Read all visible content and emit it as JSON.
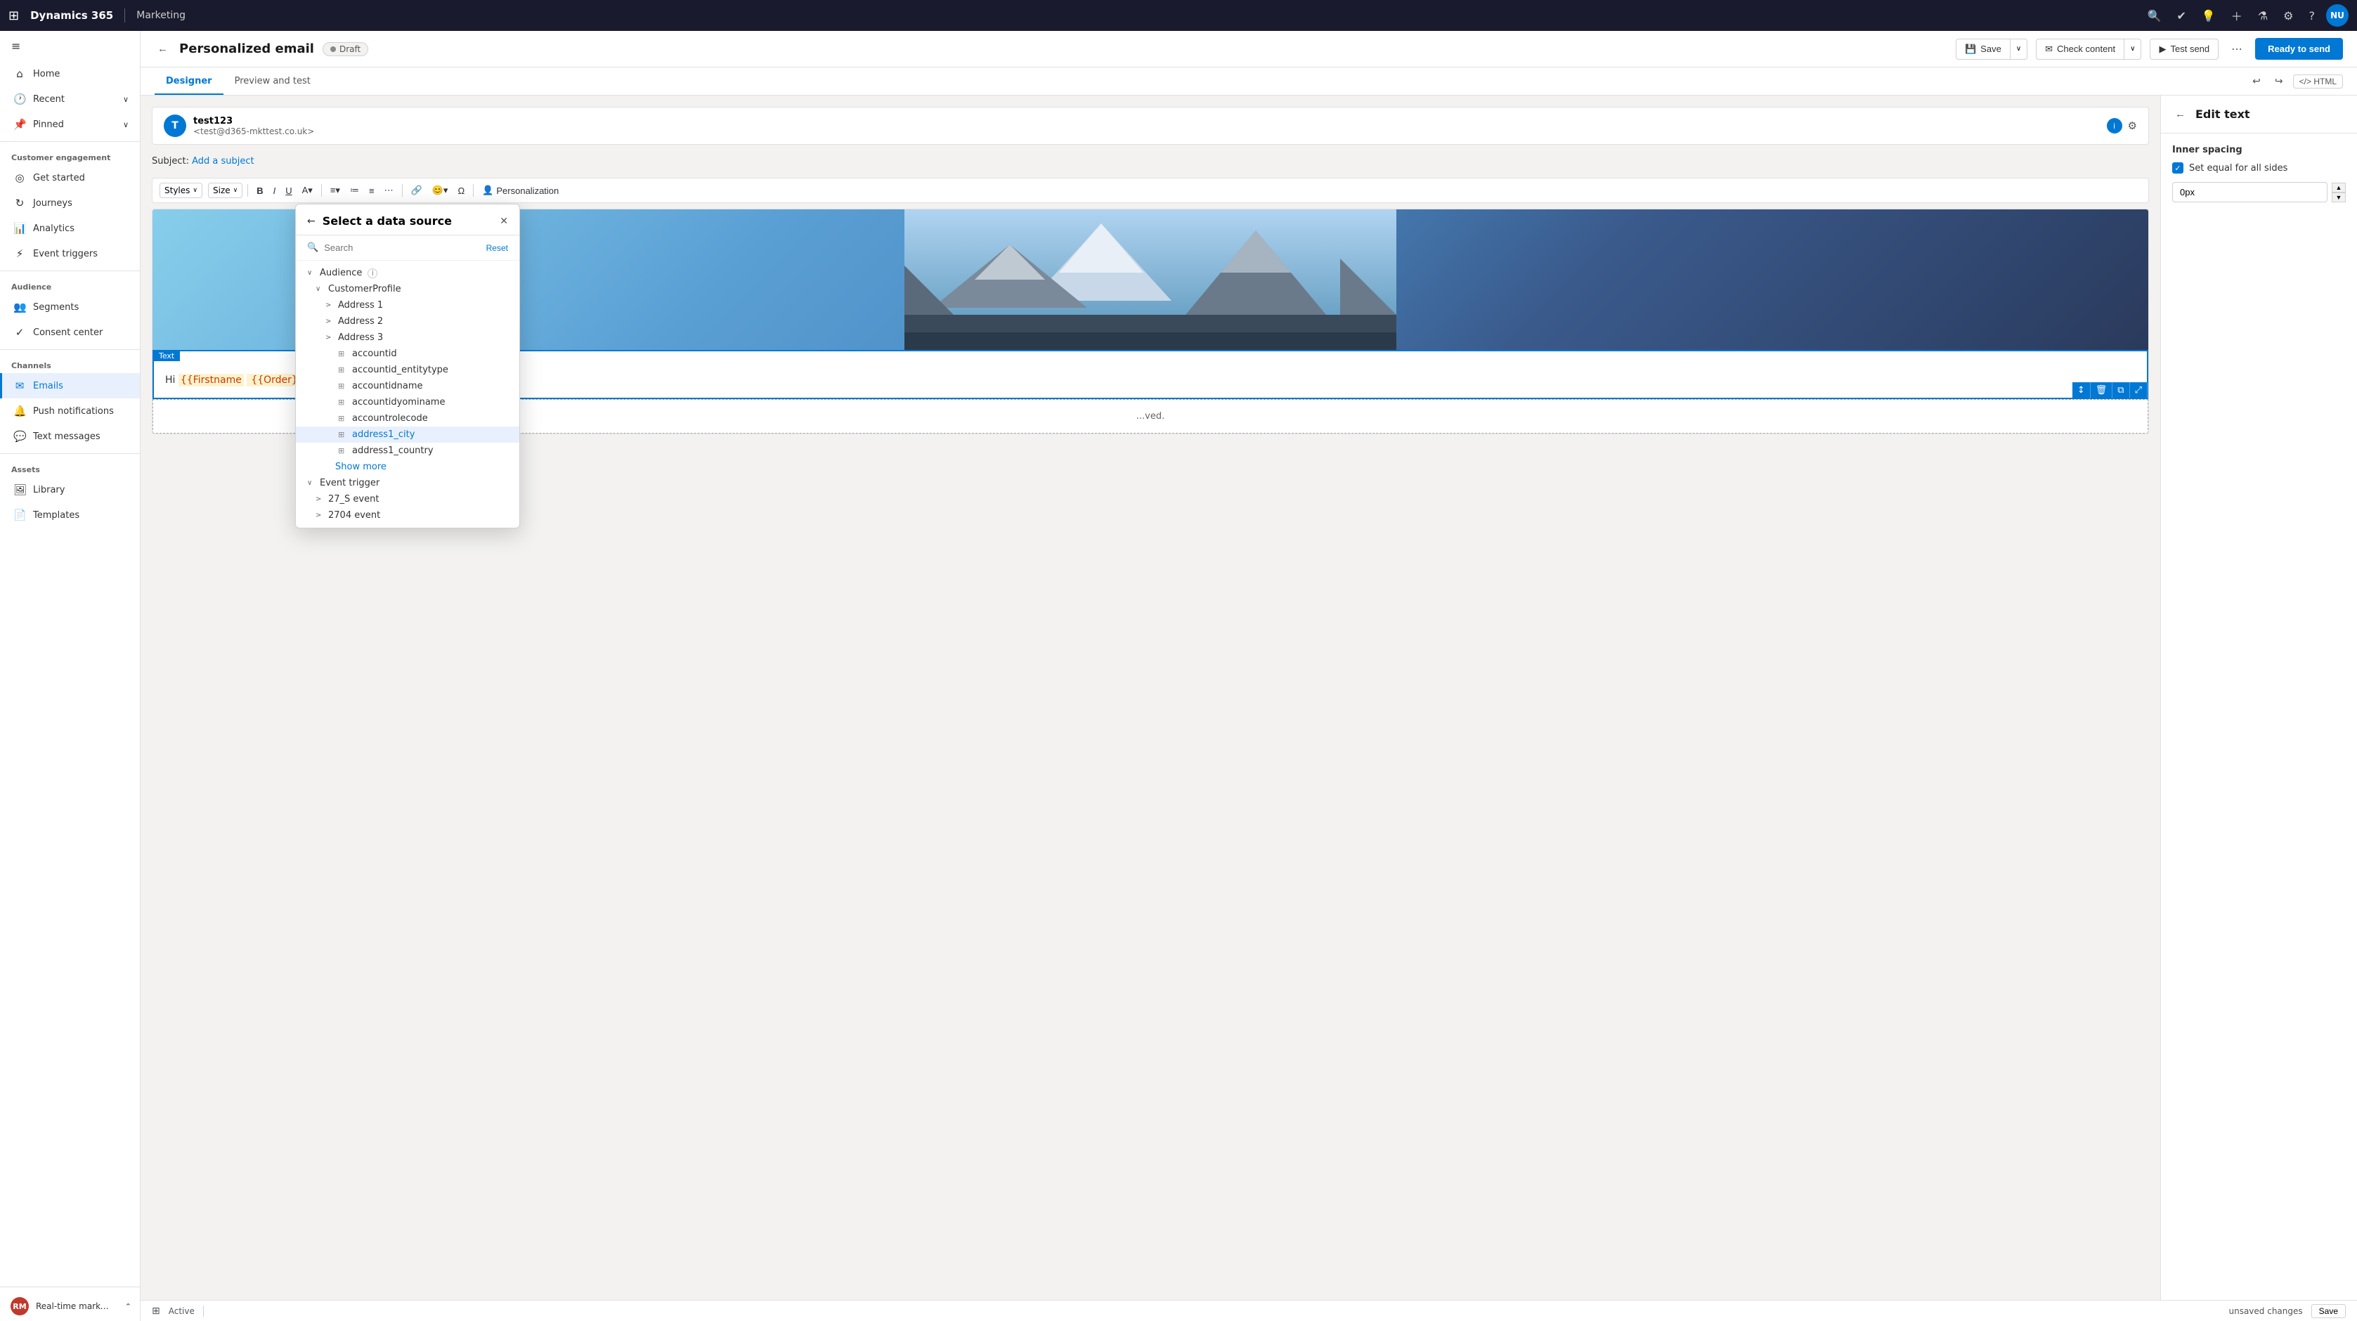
{
  "topnav": {
    "title": "Dynamics 365",
    "divider": "|",
    "module": "Marketing",
    "avatar_initials": "NU"
  },
  "sidebar": {
    "hamburger_icon": "≡",
    "nav_items": [
      {
        "id": "home",
        "label": "Home",
        "icon": "⌂"
      },
      {
        "id": "recent",
        "label": "Recent",
        "icon": "🕐",
        "has_chevron": true
      },
      {
        "id": "pinned",
        "label": "Pinned",
        "icon": "📌",
        "has_chevron": true
      }
    ],
    "sections": [
      {
        "label": "Customer engagement",
        "items": [
          {
            "id": "get-started",
            "label": "Get started",
            "icon": "◎"
          },
          {
            "id": "journeys",
            "label": "Journeys",
            "icon": "↻"
          },
          {
            "id": "analytics",
            "label": "Analytics",
            "icon": "📊"
          },
          {
            "id": "event-triggers",
            "label": "Event triggers",
            "icon": "⚡"
          }
        ]
      },
      {
        "label": "Audience",
        "items": [
          {
            "id": "segments",
            "label": "Segments",
            "icon": "👥"
          },
          {
            "id": "consent-center",
            "label": "Consent center",
            "icon": "✓"
          }
        ]
      },
      {
        "label": "Channels",
        "items": [
          {
            "id": "emails",
            "label": "Emails",
            "icon": "✉",
            "active": true
          },
          {
            "id": "push-notifications",
            "label": "Push notifications",
            "icon": "🔔"
          },
          {
            "id": "text-messages",
            "label": "Text messages",
            "icon": "💬"
          }
        ]
      },
      {
        "label": "Assets",
        "items": [
          {
            "id": "library",
            "label": "Library",
            "icon": "🖼"
          },
          {
            "id": "templates",
            "label": "Templates",
            "icon": "📄"
          }
        ]
      }
    ],
    "footer_label": "Real-time marketi...",
    "footer_icon": "RM"
  },
  "page": {
    "back_icon": "←",
    "title": "Personalized email",
    "status": "Draft",
    "status_color": "#888"
  },
  "toolbar": {
    "save_label": "Save",
    "check_content_label": "Check content",
    "test_send_label": "Test send",
    "ready_to_send_label": "Ready to send",
    "more_icon": "⋯"
  },
  "tabs": {
    "items": [
      {
        "id": "designer",
        "label": "Designer",
        "active": true
      },
      {
        "id": "preview-test",
        "label": "Preview and test",
        "active": false
      }
    ],
    "tools": {
      "undo": "↩",
      "redo": "↪",
      "html": "HTML"
    }
  },
  "email": {
    "avatar_initial": "T",
    "sender_name": "test123",
    "sender_address": "<test@d365-mkttest.co.uk>",
    "subject_prefix": "Subject:",
    "subject_placeholder": "Add a subject"
  },
  "format_toolbar": {
    "styles_label": "Styles",
    "size_label": "Size",
    "bold": "B",
    "italic": "I",
    "underline": "U",
    "more": "⋯",
    "personalization": "Personalization"
  },
  "email_content": {
    "text_block_label": "Text",
    "greeting": "Hi ",
    "firstname_token": "{{Firstname",
    "order_token": "{{Order}}",
    "bottom_text": "...ved."
  },
  "right_panel": {
    "back_icon": "←",
    "title": "Edit text",
    "inner_spacing_label": "Inner spacing",
    "equal_sides_label": "Set equal for all sides",
    "spacing_value": "0px"
  },
  "modal": {
    "title": "Select a data source",
    "back_icon": "←",
    "close_icon": "✕",
    "search_placeholder": "Search",
    "reset_label": "Reset",
    "tree": [
      {
        "id": "audience",
        "label": "Audience",
        "level": 0,
        "type": "expand",
        "expanded": true,
        "has_info": true
      },
      {
        "id": "customer-profile",
        "label": "CustomerProfile",
        "level": 1,
        "type": "expand",
        "expanded": true
      },
      {
        "id": "address1",
        "label": "Address 1",
        "level": 2,
        "type": "collapse"
      },
      {
        "id": "address2",
        "label": "Address 2",
        "level": 2,
        "type": "collapse"
      },
      {
        "id": "address3",
        "label": "Address 3",
        "level": 2,
        "type": "collapse"
      },
      {
        "id": "accountid",
        "label": "accountid",
        "level": 2,
        "type": "field"
      },
      {
        "id": "accountid-entitytype",
        "label": "accountid_entitytype",
        "level": 2,
        "type": "field"
      },
      {
        "id": "accountidname",
        "label": "accountidname",
        "level": 2,
        "type": "field"
      },
      {
        "id": "accountidyominame",
        "label": "accountidyominame",
        "level": 2,
        "type": "field"
      },
      {
        "id": "accountrolecode",
        "label": "accountrolecode",
        "level": 2,
        "type": "field"
      },
      {
        "id": "address1-city",
        "label": "address1_city",
        "level": 2,
        "type": "field",
        "selected": true
      },
      {
        "id": "address1-country",
        "label": "address1_country",
        "level": 2,
        "type": "field"
      },
      {
        "id": "show-more",
        "label": "Show more",
        "level": 2,
        "type": "show-more"
      },
      {
        "id": "event-trigger",
        "label": "Event trigger",
        "level": 0,
        "type": "expand",
        "expanded": true
      },
      {
        "id": "27s-event",
        "label": "27_S event",
        "level": 1,
        "type": "collapse"
      },
      {
        "id": "2704-event",
        "label": "2704 event",
        "level": 1,
        "type": "collapse"
      }
    ]
  },
  "status_bar": {
    "page_icon": "⊞",
    "active_label": "Active",
    "unsaved_label": "unsaved changes",
    "save_label": "Save"
  }
}
